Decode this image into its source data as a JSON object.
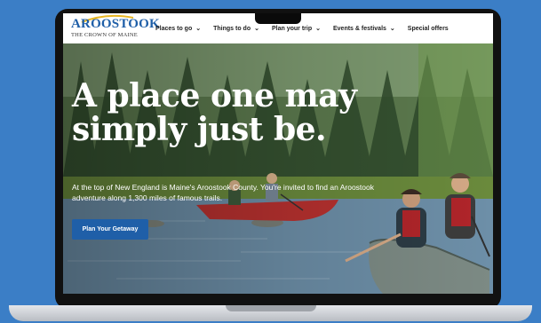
{
  "logo": {
    "wordmark": "AROOSTOOK",
    "tagline": "THE CROWN OF MAINE"
  },
  "nav": {
    "items": [
      {
        "label": "Places to go",
        "has_dropdown": true
      },
      {
        "label": "Things to do",
        "has_dropdown": true
      },
      {
        "label": "Plan your trip",
        "has_dropdown": true
      },
      {
        "label": "Events & festivals",
        "has_dropdown": true
      },
      {
        "label": "Special offers",
        "has_dropdown": false
      }
    ],
    "chevron": "⌄"
  },
  "hero": {
    "headline_line1": "A place one may",
    "headline_line2": "simply just be.",
    "subtext": "At the top of New England is Maine's Aroostook County. You're invited to find an Aroostook adventure along 1,300 miles of famous trails.",
    "cta_label": "Plan Your Getaway"
  },
  "colors": {
    "background": "#3b7ec6",
    "brand_blue": "#1f5fa8",
    "canoe_red": "#b8312f",
    "canoe_grey": "#7c8a84"
  }
}
